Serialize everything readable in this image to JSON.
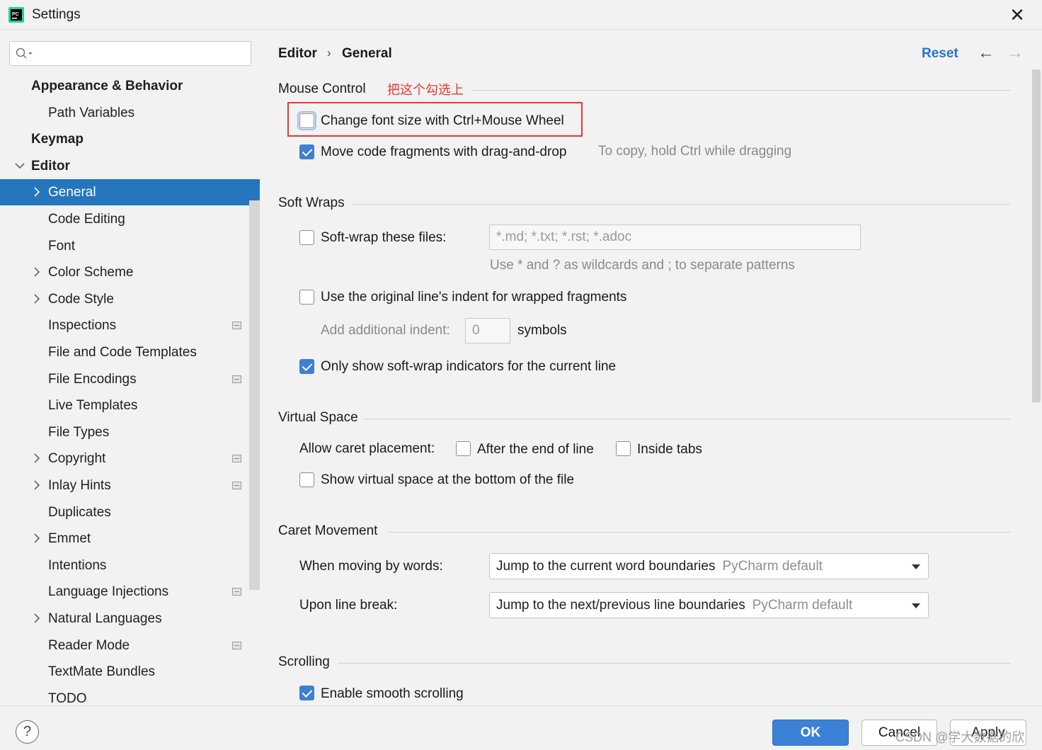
{
  "window": {
    "title": "Settings",
    "app_icon_text": "PC"
  },
  "search": {
    "placeholder": ""
  },
  "sidebar": {
    "items": [
      {
        "label": "Appearance & Behavior",
        "bold": true,
        "level": 0,
        "chevron": "none"
      },
      {
        "label": "Path Variables",
        "level": 1,
        "chevron": "none"
      },
      {
        "label": "Keymap",
        "bold": true,
        "level": 0,
        "chevron": "none"
      },
      {
        "label": "Editor",
        "bold": true,
        "level": 0,
        "chevron": "down"
      },
      {
        "label": "General",
        "level": 1,
        "chevron": "right",
        "selected": true
      },
      {
        "label": "Code Editing",
        "level": 1,
        "chevron": "none"
      },
      {
        "label": "Font",
        "level": 1,
        "chevron": "none"
      },
      {
        "label": "Color Scheme",
        "level": 1,
        "chevron": "right"
      },
      {
        "label": "Code Style",
        "level": 1,
        "chevron": "right"
      },
      {
        "label": "Inspections",
        "level": 1,
        "chevron": "none",
        "badge": true
      },
      {
        "label": "File and Code Templates",
        "level": 1,
        "chevron": "none"
      },
      {
        "label": "File Encodings",
        "level": 1,
        "chevron": "none",
        "badge": true
      },
      {
        "label": "Live Templates",
        "level": 1,
        "chevron": "none"
      },
      {
        "label": "File Types",
        "level": 1,
        "chevron": "none"
      },
      {
        "label": "Copyright",
        "level": 1,
        "chevron": "right",
        "badge": true
      },
      {
        "label": "Inlay Hints",
        "level": 1,
        "chevron": "right",
        "badge": true
      },
      {
        "label": "Duplicates",
        "level": 1,
        "chevron": "none"
      },
      {
        "label": "Emmet",
        "level": 1,
        "chevron": "right"
      },
      {
        "label": "Intentions",
        "level": 1,
        "chevron": "none"
      },
      {
        "label": "Language Injections",
        "level": 1,
        "chevron": "none",
        "badge": true
      },
      {
        "label": "Natural Languages",
        "level": 1,
        "chevron": "right"
      },
      {
        "label": "Reader Mode",
        "level": 1,
        "chevron": "none",
        "badge": true
      },
      {
        "label": "TextMate Bundles",
        "level": 1,
        "chevron": "none"
      },
      {
        "label": "TODO",
        "level": 1,
        "chevron": "none"
      }
    ]
  },
  "header": {
    "crumb_parent": "Editor",
    "crumb_separator": "›",
    "crumb_current": "General",
    "reset": "Reset"
  },
  "annotation": {
    "text": "把这个勾选上",
    "color": "#e53935"
  },
  "mouse_control": {
    "title": "Mouse Control",
    "change_font": {
      "label": "Change font size with Ctrl+Mouse Wheel",
      "checked": false
    },
    "drag_drop": {
      "label": "Move code fragments with drag-and-drop",
      "checked": true,
      "hint": "To copy, hold Ctrl while dragging"
    }
  },
  "soft_wraps": {
    "title": "Soft Wraps",
    "soft_wrap_files": {
      "label": "Soft-wrap these files:",
      "checked": false,
      "value": "*.md; *.txt; *.rst; *.adoc"
    },
    "wildcard_hint": "Use * and ? as wildcards and ; to separate patterns",
    "original_indent": {
      "label": "Use the original line's indent for wrapped fragments",
      "checked": false
    },
    "additional_indent": {
      "label": "Add additional indent:",
      "value": "0",
      "unit": "symbols"
    },
    "only_current_line": {
      "label": "Only show soft-wrap indicators for the current line",
      "checked": true
    }
  },
  "virtual_space": {
    "title": "Virtual Space",
    "caret_label": "Allow caret placement:",
    "after_end": {
      "label": "After the end of line",
      "checked": false
    },
    "inside_tabs": {
      "label": "Inside tabs",
      "checked": false
    },
    "show_virtual": {
      "label": "Show virtual space at the bottom of the file",
      "checked": false
    }
  },
  "caret_movement": {
    "title": "Caret Movement",
    "by_words": {
      "label": "When moving by words:",
      "value": "Jump to the current word boundaries",
      "default": "PyCharm default"
    },
    "line_break": {
      "label": "Upon line break:",
      "value": "Jump to the next/previous line boundaries",
      "default": "PyCharm default"
    }
  },
  "scrolling": {
    "title": "Scrolling",
    "smooth": {
      "label": "Enable smooth scrolling",
      "checked": true
    }
  },
  "footer": {
    "help": "?",
    "ok": "OK",
    "cancel": "Cancel",
    "apply": "Apply",
    "watermark": "CSDN @学大数据的欣"
  },
  "colors": {
    "accent": "#2675bf",
    "link": "#2a73c5",
    "ok_button": "#3b82d6",
    "checkbox_checked": "#3d7fd1"
  }
}
